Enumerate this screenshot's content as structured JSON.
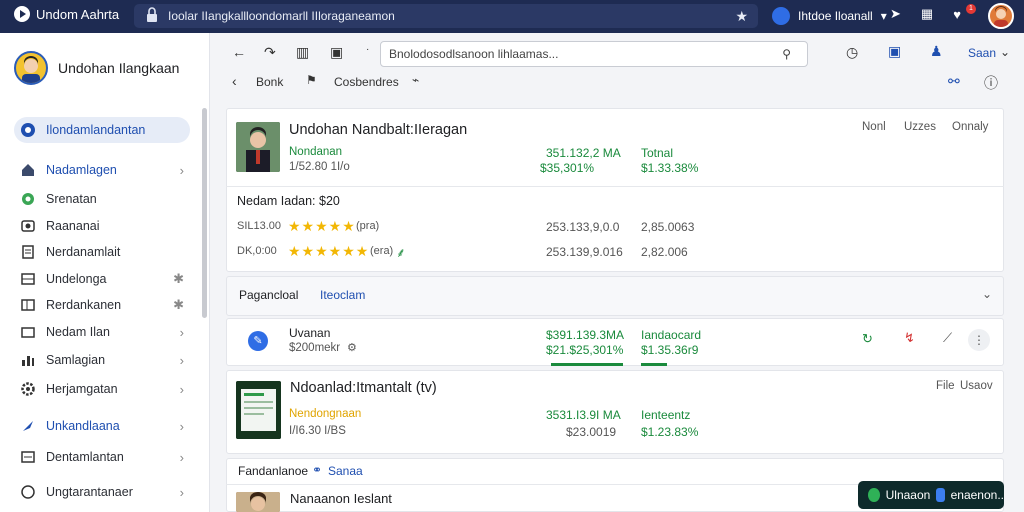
{
  "topbar": {
    "app_name": "Undom Aahrta",
    "url": "Ioolar IIangkallloondomarll IIloraganeamon",
    "account_label": "Ihtdoe Iloanall",
    "notif_count": "1"
  },
  "sidebar": {
    "profile_name": "Undohan Ilangkaan",
    "items": [
      {
        "label": "Ilondamlandantan"
      },
      {
        "label": "Nadamlagen"
      },
      {
        "label": "Srenatan"
      },
      {
        "label": "Raananai"
      },
      {
        "label": "Nerdanamlait"
      },
      {
        "label": "Undelonga"
      },
      {
        "label": "Rerdankanen"
      },
      {
        "label": "Nedam Ilan"
      },
      {
        "label": "Samlagian"
      },
      {
        "label": "Herjamgatan"
      },
      {
        "label": "Unkandlaana"
      },
      {
        "label": "Dentamlantan"
      },
      {
        "label": "Ungtarantanaer"
      }
    ]
  },
  "toolbar": {
    "search_text": "Bnolodosodlsanoon lihlaamas...",
    "save_label": "Saan",
    "back_label": "Bonk",
    "section_label": "Cosbendres"
  },
  "card1": {
    "title": "Undohan Nandbalt:IIeragan",
    "sub_green": "Nondanan",
    "sub_muted": "1/52.80 1I/o",
    "col_a_top": "351.132,2 MA",
    "col_a_bottom": "$35,301%",
    "col_b_top": "Totnal",
    "col_b_bottom": "$1.33.38%",
    "header_r1": "Nonl",
    "header_r2": "Uzzes",
    "header_r3": "Onnaly",
    "price_line": "Nedam Iadan: $20",
    "row1_label": "SIL13.00",
    "row1_extra": "(pra)",
    "row1_val": "253.133,9,0.0",
    "row1_val2": "2,85.0063",
    "row2_label": "DK,0:00",
    "row2_extra": "(era)",
    "row2_val": "253.139,9.016",
    "row2_val2": "2,82.006"
  },
  "section": {
    "title_a": "Pagancloal",
    "title_b": "Iteoclam"
  },
  "row_card": {
    "title": "Uvanan",
    "sub": "$200mekr",
    "col_a_top": "$391.139.3MA",
    "col_a_bottom": "$21.$25,301%",
    "col_b_top": "Iandaocard",
    "col_b_bottom": "$1.35.36r9"
  },
  "card2": {
    "title": "Ndoanlad:Itmantalt (tv)",
    "sub_gold": "Nendongnaan",
    "sub_muted": "I/I6.30 I/BS",
    "col_a_top": "3531.I3.9I MA",
    "col_a_bottom": "$23.0019",
    "col_b_top": "Ienteentz",
    "col_b_bottom": "$1.23.83%",
    "header_r1": "File",
    "header_r2": "Usaov"
  },
  "footer_strip": {
    "label": "Fandanlanoe",
    "link": "Sanaa",
    "next_title": "Nanaanon Ieslant"
  },
  "chip": {
    "left": "Ulnaaon",
    "right": "enaenon.."
  },
  "colors": {
    "topbar": "#1e2b52",
    "accent": "#1f4fb0",
    "green": "#1a8a3c",
    "gold": "#e0a400"
  }
}
